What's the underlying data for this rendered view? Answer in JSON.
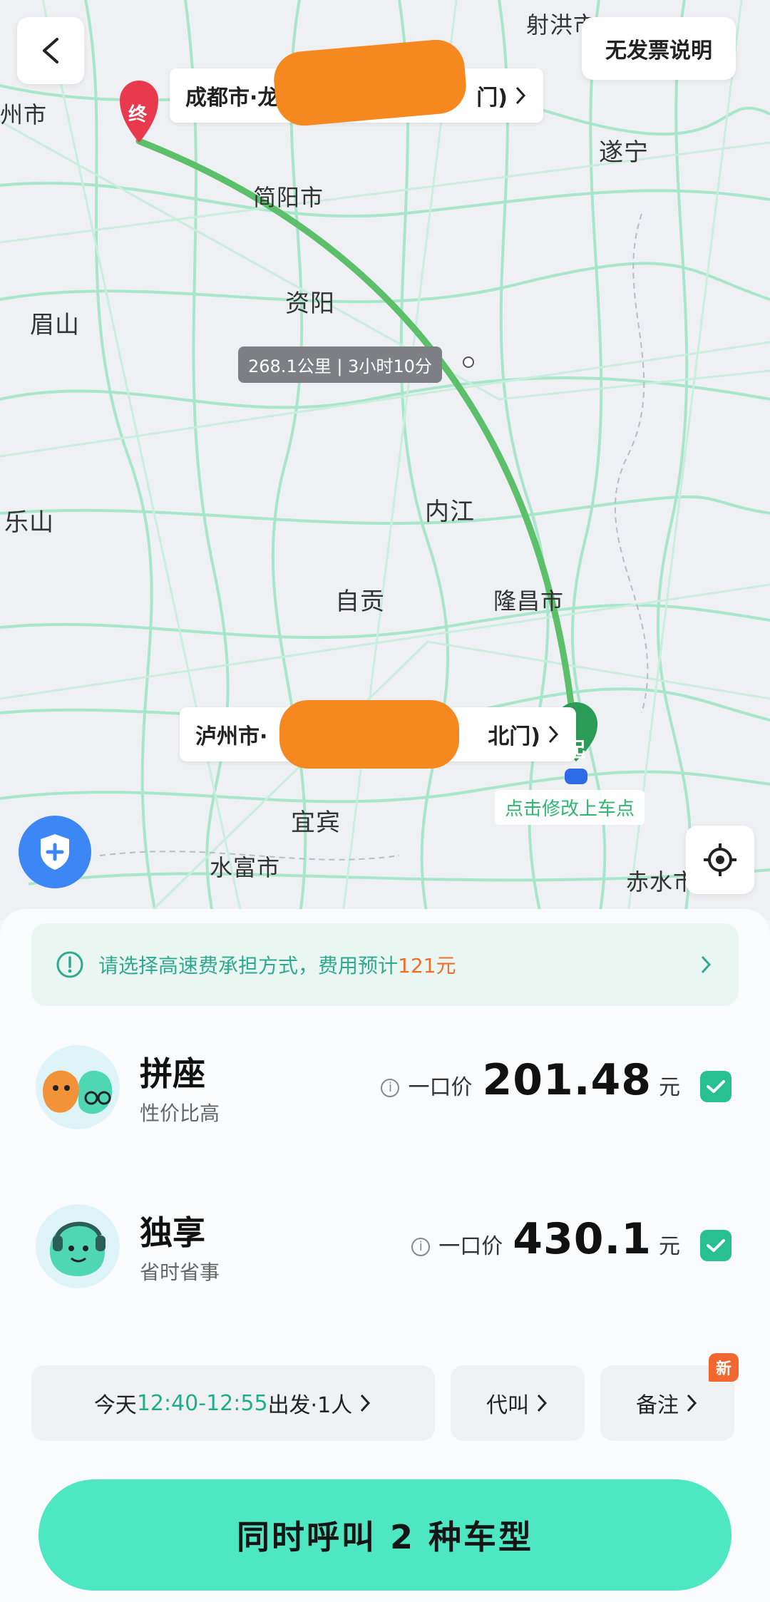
{
  "header": {
    "back_icon": "chevron-left-icon",
    "no_invoice_label": "无发票说明"
  },
  "map": {
    "cities": {
      "shehong": "射洪市",
      "zhoushi": "州市",
      "suining": "遂宁",
      "jianyang": "简阳市",
      "ziyang": "资阳",
      "meishan": "眉山",
      "leshan": "乐山",
      "neijiang": "内江",
      "zigong": "自贡",
      "longchang": "隆昌市",
      "yibin": "宜宾",
      "shuifu": "水富市",
      "chishui": "赤水市"
    },
    "destination": {
      "marker": "终",
      "label_prefix": "成都市·龙",
      "label_suffix": "门)"
    },
    "origin": {
      "marker": "起",
      "label_prefix": "泸州市·",
      "label_suffix": "北门)",
      "pickup_hint": "点击修改上车点"
    },
    "route_info": "268.1公里 | 3小时10分",
    "colors": {
      "route": "#5cbf6a",
      "road": "#9fe3c4",
      "dest_pin": "#e83a4c",
      "origin_pin": "#2c9b55"
    }
  },
  "notice": {
    "text": "请选择高速费承担方式，费用预计",
    "amount": "121元"
  },
  "rides": [
    {
      "name": "拼座",
      "desc": "性价比高",
      "price_label": "一口价",
      "price": "201.48",
      "unit": "元",
      "selected": true
    },
    {
      "name": "独享",
      "desc": "省时省事",
      "price_label": "一口价",
      "price": "430.1",
      "unit": "元",
      "selected": true
    }
  ],
  "options": {
    "time_prefix": "今天 ",
    "time_range": "12:40-12:55",
    "time_suffix": " 出发·1人",
    "proxy_call": "代叫",
    "remark": "备注",
    "new_badge": "新"
  },
  "cta": {
    "label": "同时呼叫 2 种车型"
  },
  "accent": {
    "primary": "#4de8c2",
    "check": "#28c08f",
    "highlight": "#f36d2a"
  }
}
